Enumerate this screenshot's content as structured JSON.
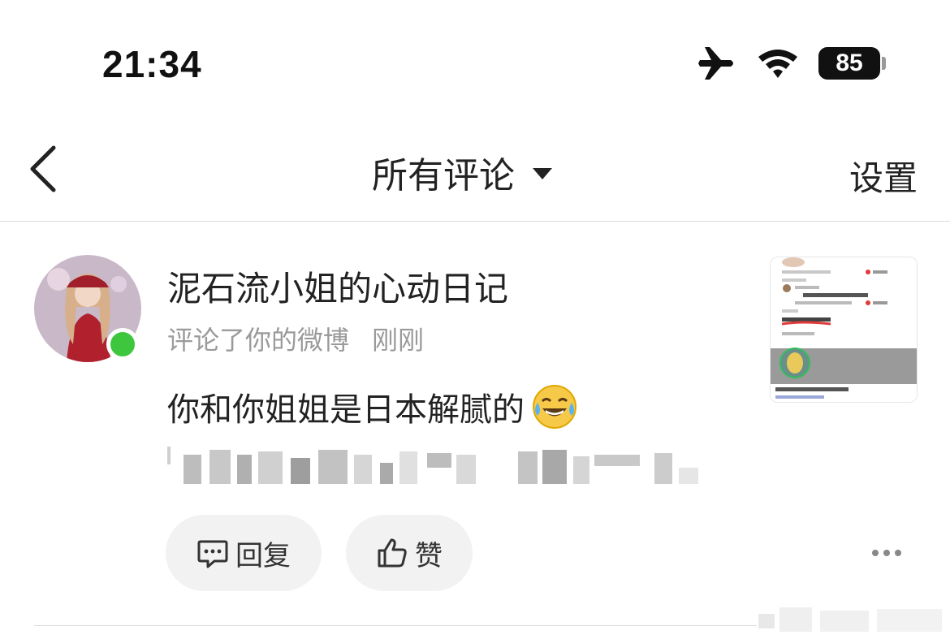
{
  "status_bar": {
    "time": "21:34",
    "battery": "85"
  },
  "nav": {
    "title": "所有评论",
    "settings_label": "设置"
  },
  "comment": {
    "username": "泥石流小姐的心动日记",
    "action": "评论了你的微博",
    "time_ago": "刚刚",
    "text": "你和你姐姐是日本解腻的",
    "emoji": "tears-of-joy-emoji"
  },
  "actions": {
    "reply_label": "回复",
    "like_label": "赞"
  },
  "icons": [
    "back-icon",
    "dropdown-caret-icon",
    "airplane-icon",
    "wifi-icon",
    "battery-icon",
    "reply-icon",
    "like-icon",
    "more-icon"
  ],
  "colors": {
    "online": "#3ec73e",
    "meta_text": "#9a9a9a",
    "button_bg": "#f2f2f2"
  }
}
